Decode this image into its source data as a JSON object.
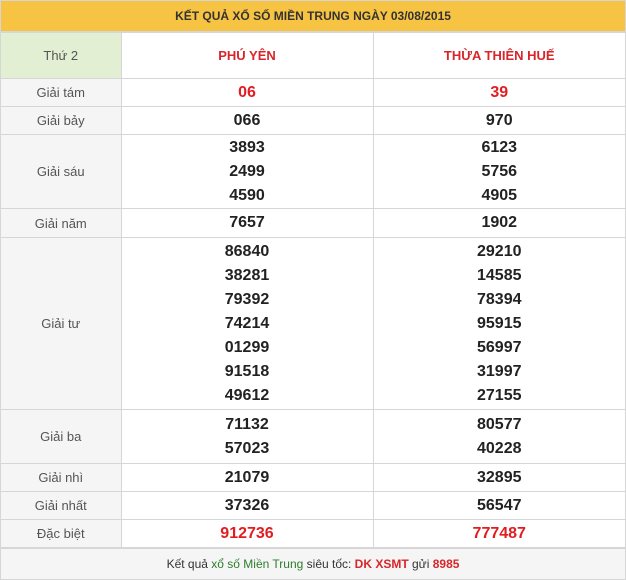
{
  "title": "KẾT QUẢ XỔ SỐ MIỀN TRUNG NGÀY 03/08/2015",
  "header": {
    "day": "Thứ 2",
    "provinces": [
      "PHÚ YÊN",
      "THỪA THIÊN HUẾ"
    ]
  },
  "rows": [
    {
      "label": "Giải tám",
      "values": [
        [
          "06"
        ],
        [
          "39"
        ]
      ]
    },
    {
      "label": "Giải bảy",
      "values": [
        [
          "066"
        ],
        [
          "970"
        ]
      ]
    },
    {
      "label": "Giải sáu",
      "values": [
        [
          "3893",
          "2499",
          "4590"
        ],
        [
          "6123",
          "5756",
          "4905"
        ]
      ]
    },
    {
      "label": "Giải năm",
      "values": [
        [
          "7657"
        ],
        [
          "1902"
        ]
      ]
    },
    {
      "label": "Giải tư",
      "values": [
        [
          "86840",
          "38281",
          "79392",
          "74214",
          "01299",
          "91518",
          "49612"
        ],
        [
          "29210",
          "14585",
          "78394",
          "95915",
          "56997",
          "31997",
          "27155"
        ]
      ]
    },
    {
      "label": "Giải ba",
      "values": [
        [
          "71132",
          "57023"
        ],
        [
          "80577",
          "40228"
        ]
      ]
    },
    {
      "label": "Giải nhì",
      "values": [
        [
          "21079"
        ],
        [
          "32895"
        ]
      ]
    },
    {
      "label": "Giải nhất",
      "values": [
        [
          "37326"
        ],
        [
          "56547"
        ]
      ]
    },
    {
      "label": "Đặc biệt",
      "values": [
        [
          "912736"
        ],
        [
          "777487"
        ]
      ]
    }
  ],
  "footer": {
    "prefix": "Kết quả ",
    "link": "xổ số Miền Trung",
    "middle": " siêu tốc: ",
    "code": "DK XSMT",
    "send": " gửi ",
    "number": "8985"
  }
}
